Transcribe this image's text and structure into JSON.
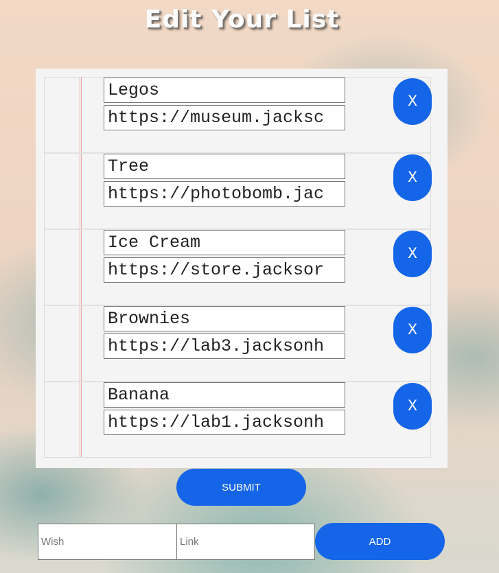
{
  "page": {
    "title": "Edit Your List"
  },
  "items": [
    {
      "wish": "Legos",
      "link": "https://museum.jacksc",
      "delete_label": "X"
    },
    {
      "wish": "Tree",
      "link": "https://photobomb.jac",
      "delete_label": "X"
    },
    {
      "wish": "Ice Cream",
      "link": "https://store.jacksor",
      "delete_label": "X"
    },
    {
      "wish": "Brownies",
      "link": "https://lab3.jacksonh",
      "delete_label": "X"
    },
    {
      "wish": "Banana",
      "link": "https://lab1.jacksonh",
      "delete_label": "X"
    }
  ],
  "actions": {
    "submit_label": "SUBMIT",
    "add_label": "ADD"
  },
  "new_item": {
    "wish_placeholder": "Wish",
    "wish_value": "",
    "link_placeholder": "Link",
    "link_value": ""
  },
  "colors": {
    "button": "#1565e8",
    "panel": "#f4f4f4",
    "margin_line": "#e7a8a0"
  }
}
